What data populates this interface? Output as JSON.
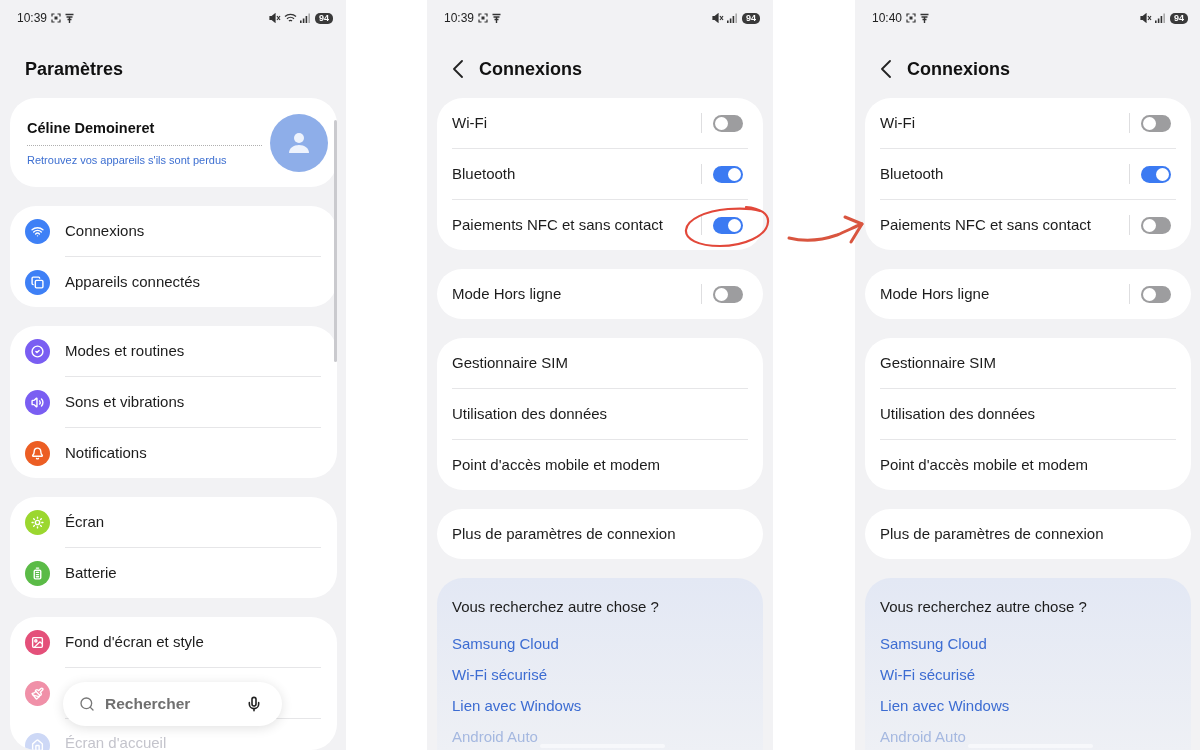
{
  "screens": [
    {
      "kind": "home",
      "status_bar": {
        "time": "10:39",
        "wifi": true,
        "battery": "94"
      },
      "title": "Paramètres",
      "profile": {
        "name": "Céline Demoineret",
        "link": "Retrouvez vos appareils s'ils sont perdus"
      },
      "groups": [
        {
          "items": [
            {
              "label": "Connexions",
              "color": "#3e80f6"
            },
            {
              "label": "Appareils connectés",
              "color": "#3e80f6"
            }
          ]
        },
        {
          "items": [
            {
              "label": "Modes et routines",
              "color": "#7a5ef2"
            },
            {
              "label": "Sons et vibrations",
              "color": "#7a5ef2"
            },
            {
              "label": "Notifications",
              "color": "#ec5e24"
            }
          ]
        },
        {
          "items": [
            {
              "label": "Écran",
              "color": "#9bd72f"
            },
            {
              "label": "Batterie",
              "color": "#5bbb47"
            }
          ]
        },
        {
          "items": [
            {
              "label": "Fond d'écran et style",
              "color": "#e4507a"
            },
            {
              "color": "#f090a8"
            },
            {
              "label": "Écran d'accueil",
              "color": "#cdd8f6"
            }
          ]
        }
      ],
      "search": {
        "placeholder": "Rechercher"
      }
    },
    {
      "kind": "connections",
      "status_bar": {
        "time": "10:39",
        "wifi": false,
        "battery": "94"
      },
      "title": "Connexions",
      "cards": [
        {
          "items": [
            {
              "label": "Wi-Fi",
              "kind": "toggle",
              "on": false,
              "circled": false
            },
            {
              "label": "Bluetooth",
              "kind": "toggle",
              "on": true,
              "circled": false
            },
            {
              "label": "Paiements NFC et sans contact",
              "kind": "toggle",
              "on": true,
              "circled": true
            }
          ]
        },
        {
          "items": [
            {
              "label": "Mode Hors ligne",
              "kind": "toggle",
              "on": false,
              "circled": false
            }
          ]
        },
        {
          "items": [
            {
              "label": "Gestionnaire SIM",
              "kind": "link"
            },
            {
              "label": "Utilisation des données",
              "kind": "link"
            },
            {
              "label": "Point d'accès mobile et modem",
              "kind": "link"
            }
          ]
        },
        {
          "items": [
            {
              "label": "Plus de paramètres de connexion",
              "kind": "link"
            }
          ]
        }
      ],
      "help": {
        "title": "Vous recherchez autre chose ?",
        "links": [
          "Samsung Cloud",
          "Wi-Fi sécurisé",
          "Lien avec Windows",
          "Android Auto"
        ]
      }
    },
    {
      "kind": "connections",
      "status_bar": {
        "time": "10:40",
        "wifi": false,
        "battery": "94"
      },
      "title": "Connexions",
      "cards": [
        {
          "items": [
            {
              "label": "Wi-Fi",
              "kind": "toggle",
              "on": false,
              "circled": false
            },
            {
              "label": "Bluetooth",
              "kind": "toggle",
              "on": true,
              "circled": false
            },
            {
              "label": "Paiements NFC et sans contact",
              "kind": "toggle",
              "on": false,
              "circled": false
            }
          ]
        },
        {
          "items": [
            {
              "label": "Mode Hors ligne",
              "kind": "toggle",
              "on": false,
              "circled": false
            }
          ]
        },
        {
          "items": [
            {
              "label": "Gestionnaire SIM",
              "kind": "link"
            },
            {
              "label": "Utilisation des données",
              "kind": "link"
            },
            {
              "label": "Point d'accès mobile et modem",
              "kind": "link"
            }
          ]
        },
        {
          "items": [
            {
              "label": "Plus de paramètres de connexion",
              "kind": "link"
            }
          ]
        }
      ],
      "help": {
        "title": "Vous recherchez autre chose ?",
        "links": [
          "Samsung Cloud",
          "Wi-Fi sécurisé",
          "Lien avec Windows",
          "Android Auto"
        ]
      }
    }
  ]
}
